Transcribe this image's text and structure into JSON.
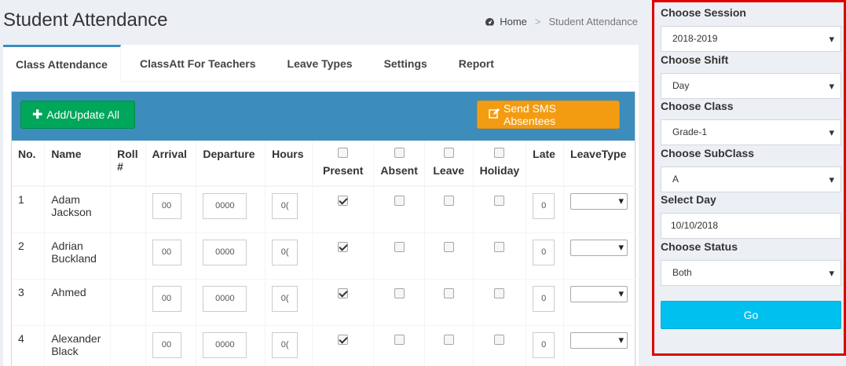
{
  "header": {
    "title": "Student Attendance",
    "breadcrumb": {
      "home": "Home",
      "separator": ">",
      "current": "Student Attendance"
    }
  },
  "tabs": [
    {
      "label": "Class Attendance",
      "active": true
    },
    {
      "label": "ClassAtt For Teachers",
      "active": false
    },
    {
      "label": "Leave Types",
      "active": false
    },
    {
      "label": "Settings",
      "active": false
    },
    {
      "label": "Report",
      "active": false
    }
  ],
  "toolbar": {
    "add_update_label": "Add/Update All",
    "sms_label": "Send SMS Absentees"
  },
  "table": {
    "columns": {
      "no": "No.",
      "name": "Name",
      "roll": "Roll #",
      "arrival": "Arrival",
      "departure": "Departure",
      "hours": "Hours",
      "present": "Present",
      "absent": "Absent",
      "leave": "Leave",
      "holiday": "Holiday",
      "late": "Late",
      "leavetype": "LeaveType"
    },
    "rows": [
      {
        "no": "1",
        "name": "Adam Jackson",
        "roll": "",
        "arrival": "00",
        "departure": "0000",
        "hours": "0(",
        "present": true,
        "absent": false,
        "leave": false,
        "holiday": false,
        "late": "0"
      },
      {
        "no": "2",
        "name": "Adrian Buckland",
        "roll": "",
        "arrival": "00",
        "departure": "0000",
        "hours": "0(",
        "present": true,
        "absent": false,
        "leave": false,
        "holiday": false,
        "late": "0"
      },
      {
        "no": "3",
        "name": "Ahmed",
        "roll": "",
        "arrival": "00",
        "departure": "0000",
        "hours": "0(",
        "present": true,
        "absent": false,
        "leave": false,
        "holiday": false,
        "late": "0"
      },
      {
        "no": "4",
        "name": "Alexander Black",
        "roll": "",
        "arrival": "00",
        "departure": "0000",
        "hours": "0(",
        "present": true,
        "absent": false,
        "leave": false,
        "holiday": false,
        "late": "0"
      }
    ]
  },
  "sidebar": {
    "session": {
      "label": "Choose Session",
      "value": "2018-2019"
    },
    "shift": {
      "label": "Choose Shift",
      "value": "Day"
    },
    "class": {
      "label": "Choose Class",
      "value": "Grade-1"
    },
    "subclass": {
      "label": "Choose SubClass",
      "value": "A"
    },
    "day": {
      "label": "Select Day",
      "value": "10/10/2018"
    },
    "status": {
      "label": "Choose Status",
      "value": "Both"
    },
    "go_label": "Go"
  },
  "colors": {
    "primary": "#3c8dbc",
    "success": "#00a65a",
    "warning": "#f39c12",
    "info": "#00c0ef",
    "highlight": "#e00000",
    "background": "#ecf0f5"
  }
}
